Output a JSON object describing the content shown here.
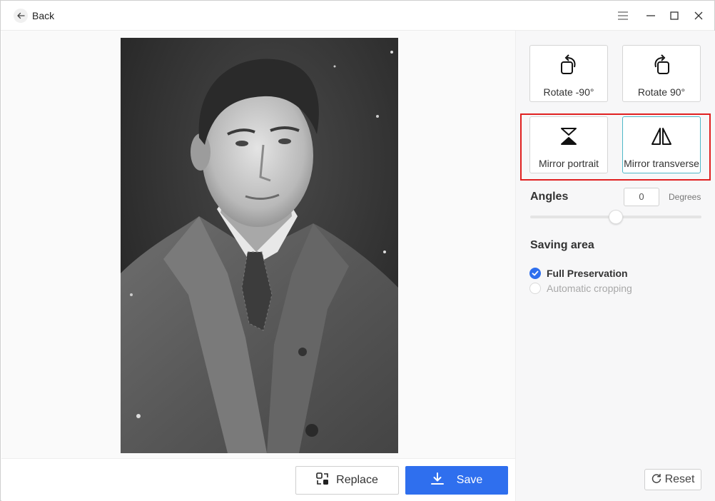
{
  "titlebar": {
    "back_label": "Back"
  },
  "icons": {
    "back": "arrow-left-icon",
    "menu": "hamburger-menu-icon",
    "minimize": "minimize-icon",
    "maximize": "maximize-icon",
    "close": "close-icon"
  },
  "main": {
    "photo_description_alt": "",
    "replace_label": "Replace",
    "save_label": "Save"
  },
  "panel": {
    "tools": [
      {
        "label": "Rotate -90°",
        "icon": "rotate-left-icon"
      },
      {
        "label": "Rotate 90°",
        "icon": "rotate-right-icon"
      },
      {
        "label": "Mirror portrait",
        "icon": "flip-vertical-icon"
      },
      {
        "label": "Mirror transverse",
        "icon": "flip-horizontal-icon"
      }
    ],
    "angles_label": "Angles",
    "angle_value": "0",
    "degrees_label": "Degrees",
    "angle_slider_fraction": 0.5,
    "saving_area_label": "Saving area",
    "options": [
      {
        "label": "Full Preservation",
        "selected": true
      },
      {
        "label": "Automatic cropping",
        "selected": false
      }
    ],
    "reset_label": "Reset"
  },
  "colors": {
    "accent": "#2f6fee",
    "active_border": "#4fb8c8",
    "highlight_box": "#e02020"
  }
}
